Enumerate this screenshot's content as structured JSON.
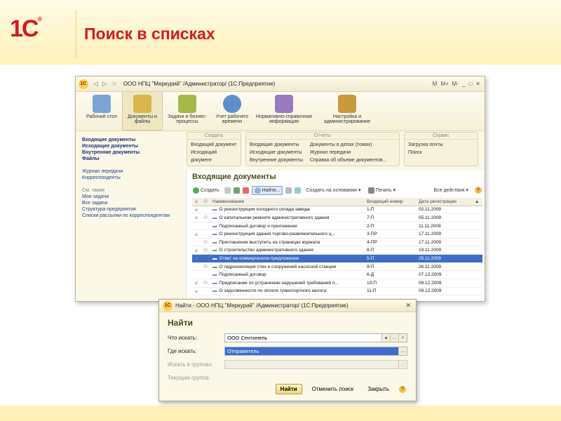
{
  "slide": {
    "logo": "1С",
    "logo_mark": "®",
    "title": "Поиск в списках"
  },
  "main_window": {
    "title": "ООО НПЦ \"Меркурий\" /Администратор/  (1С:Предприятие)",
    "toolbar_right": [
      "M",
      "M+",
      "M-"
    ],
    "sections": [
      {
        "label": "Рабочий стол",
        "color": "#7aa5d6"
      },
      {
        "label": "Документы и файлы",
        "color": "#d9b54a"
      },
      {
        "label": "Задачи и бизнес-процессы",
        "color": "#a5b84a"
      },
      {
        "label": "Учет рабочего времени",
        "color": "#5c8fd0"
      },
      {
        "label": "Нормативно-справочная информация",
        "color": "#9a7bc0"
      },
      {
        "label": "Настройка и администрирование",
        "color": "#c99a3a"
      }
    ],
    "nav": {
      "bold": [
        "Входящие документы",
        "Исходящие документы",
        "Внутренние документы",
        "Файлы"
      ],
      "links1": [
        "Журнал передачи",
        "Корреспонденты"
      ],
      "see_also": "См. также",
      "links2": [
        "Мои задачи",
        "Все задачи",
        "Структура предприятия",
        "Списки рассылки по корреспондентам"
      ]
    },
    "groups": {
      "create": {
        "title": "Создать",
        "items": [
          "Входящий документ",
          "Исходящий документ"
        ]
      },
      "reports": {
        "title": "Отчеты",
        "col1": [
          "Входящие документы",
          "Исходящие документы",
          "Внутренние документы"
        ],
        "col2": [
          "Документы в делах (томах)",
          "Журнал передачи",
          "Справка об объеме документов..."
        ]
      },
      "service": {
        "title": "Сервис",
        "items": [
          "Загрузка почты",
          "Поиск"
        ]
      }
    },
    "list": {
      "title": "Входящие документы",
      "cmd": {
        "create": "Создать",
        "find": "Найти...",
        "create_based": "Создать на основании",
        "print": "Печать",
        "all_actions": "Все действия"
      },
      "columns": [
        "Наименование",
        "Входящий номер",
        "Дата регистрации"
      ],
      "rows": [
        {
          "clip": true,
          "group": false,
          "name": "О реконструкции холодного склада завода",
          "num": "1-П",
          "date": "02.11.2009"
        },
        {
          "clip": true,
          "group": true,
          "name": "О капитальном ремонте административного здания",
          "num": "7-П",
          "date": "05.11.2009"
        },
        {
          "clip": false,
          "group": false,
          "name": "Подписанный договор и приложение",
          "num": "2-П",
          "date": "11.11.2009"
        },
        {
          "clip": true,
          "group": false,
          "name": "О реконструкция здания торгово-развлекательного ц...",
          "num": "3-ПР",
          "date": "17.11.2009"
        },
        {
          "clip": false,
          "group": true,
          "name": "Приглашение выступить на страницах журнала",
          "num": "4-ПР",
          "date": "17.11.2009"
        },
        {
          "clip": true,
          "group": true,
          "name": "О строительство административного здания",
          "num": "8-П",
          "date": "19.11.2009"
        },
        {
          "clip": true,
          "group": false,
          "name": "Ответ на коммерческое предложение",
          "num": "5-П",
          "date": "25.11.2009",
          "selected": true
        },
        {
          "clip": false,
          "group": true,
          "name": "О гидроизоляция стен и сооружений насосной станции",
          "num": "9-П",
          "date": "26.11.2009"
        },
        {
          "clip": false,
          "group": false,
          "name": "Подписанный договор",
          "num": "6-Д",
          "date": "07.12.2009"
        },
        {
          "clip": true,
          "group": true,
          "name": "Предписание по устранению нарушений требований п...",
          "num": "10-П",
          "date": "08.12.2009"
        },
        {
          "clip": true,
          "group": false,
          "name": "О задолженности по оплате транспортного налога",
          "num": "11-П",
          "date": "09.12.2009"
        }
      ]
    }
  },
  "find_dialog": {
    "title": "Найти - ООО НПЦ \"Меркурий\" /Администратор/  (1С:Предприятие)",
    "heading": "Найти",
    "what_label": "Что искать:",
    "what_value": "ООО Сентинель",
    "where_label": "Где искать:",
    "where_value": "Отправитель",
    "in_groups_label": "Искать в группах:",
    "current_group_label": "Текущая группа:",
    "btn_find": "Найти",
    "btn_cancel_search": "Отменить поиск",
    "btn_close": "Закрыть"
  }
}
